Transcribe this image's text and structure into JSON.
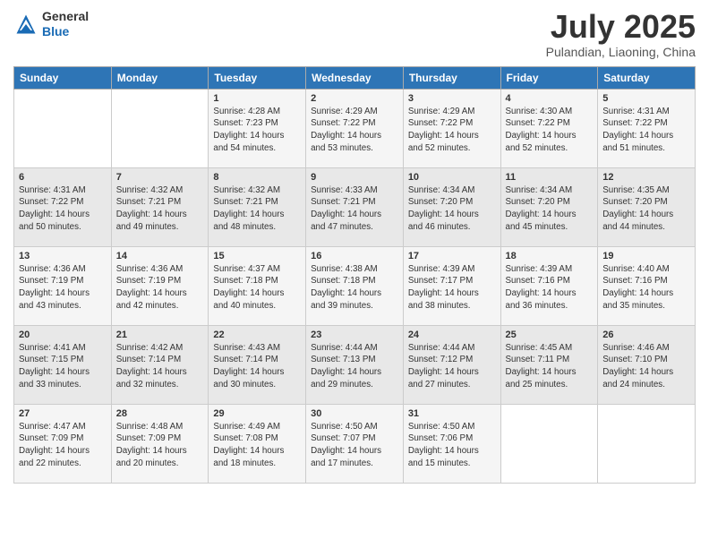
{
  "header": {
    "logo_line1": "General",
    "logo_line2": "Blue",
    "month_title": "July 2025",
    "location": "Pulandian, Liaoning, China"
  },
  "days_of_week": [
    "Sunday",
    "Monday",
    "Tuesday",
    "Wednesday",
    "Thursday",
    "Friday",
    "Saturday"
  ],
  "weeks": [
    [
      {
        "day": "",
        "info": ""
      },
      {
        "day": "",
        "info": ""
      },
      {
        "day": "1",
        "info": "Sunrise: 4:28 AM\nSunset: 7:23 PM\nDaylight: 14 hours and 54 minutes."
      },
      {
        "day": "2",
        "info": "Sunrise: 4:29 AM\nSunset: 7:22 PM\nDaylight: 14 hours and 53 minutes."
      },
      {
        "day": "3",
        "info": "Sunrise: 4:29 AM\nSunset: 7:22 PM\nDaylight: 14 hours and 52 minutes."
      },
      {
        "day": "4",
        "info": "Sunrise: 4:30 AM\nSunset: 7:22 PM\nDaylight: 14 hours and 52 minutes."
      },
      {
        "day": "5",
        "info": "Sunrise: 4:31 AM\nSunset: 7:22 PM\nDaylight: 14 hours and 51 minutes."
      }
    ],
    [
      {
        "day": "6",
        "info": "Sunrise: 4:31 AM\nSunset: 7:22 PM\nDaylight: 14 hours and 50 minutes."
      },
      {
        "day": "7",
        "info": "Sunrise: 4:32 AM\nSunset: 7:21 PM\nDaylight: 14 hours and 49 minutes."
      },
      {
        "day": "8",
        "info": "Sunrise: 4:32 AM\nSunset: 7:21 PM\nDaylight: 14 hours and 48 minutes."
      },
      {
        "day": "9",
        "info": "Sunrise: 4:33 AM\nSunset: 7:21 PM\nDaylight: 14 hours and 47 minutes."
      },
      {
        "day": "10",
        "info": "Sunrise: 4:34 AM\nSunset: 7:20 PM\nDaylight: 14 hours and 46 minutes."
      },
      {
        "day": "11",
        "info": "Sunrise: 4:34 AM\nSunset: 7:20 PM\nDaylight: 14 hours and 45 minutes."
      },
      {
        "day": "12",
        "info": "Sunrise: 4:35 AM\nSunset: 7:20 PM\nDaylight: 14 hours and 44 minutes."
      }
    ],
    [
      {
        "day": "13",
        "info": "Sunrise: 4:36 AM\nSunset: 7:19 PM\nDaylight: 14 hours and 43 minutes."
      },
      {
        "day": "14",
        "info": "Sunrise: 4:36 AM\nSunset: 7:19 PM\nDaylight: 14 hours and 42 minutes."
      },
      {
        "day": "15",
        "info": "Sunrise: 4:37 AM\nSunset: 7:18 PM\nDaylight: 14 hours and 40 minutes."
      },
      {
        "day": "16",
        "info": "Sunrise: 4:38 AM\nSunset: 7:18 PM\nDaylight: 14 hours and 39 minutes."
      },
      {
        "day": "17",
        "info": "Sunrise: 4:39 AM\nSunset: 7:17 PM\nDaylight: 14 hours and 38 minutes."
      },
      {
        "day": "18",
        "info": "Sunrise: 4:39 AM\nSunset: 7:16 PM\nDaylight: 14 hours and 36 minutes."
      },
      {
        "day": "19",
        "info": "Sunrise: 4:40 AM\nSunset: 7:16 PM\nDaylight: 14 hours and 35 minutes."
      }
    ],
    [
      {
        "day": "20",
        "info": "Sunrise: 4:41 AM\nSunset: 7:15 PM\nDaylight: 14 hours and 33 minutes."
      },
      {
        "day": "21",
        "info": "Sunrise: 4:42 AM\nSunset: 7:14 PM\nDaylight: 14 hours and 32 minutes."
      },
      {
        "day": "22",
        "info": "Sunrise: 4:43 AM\nSunset: 7:14 PM\nDaylight: 14 hours and 30 minutes."
      },
      {
        "day": "23",
        "info": "Sunrise: 4:44 AM\nSunset: 7:13 PM\nDaylight: 14 hours and 29 minutes."
      },
      {
        "day": "24",
        "info": "Sunrise: 4:44 AM\nSunset: 7:12 PM\nDaylight: 14 hours and 27 minutes."
      },
      {
        "day": "25",
        "info": "Sunrise: 4:45 AM\nSunset: 7:11 PM\nDaylight: 14 hours and 25 minutes."
      },
      {
        "day": "26",
        "info": "Sunrise: 4:46 AM\nSunset: 7:10 PM\nDaylight: 14 hours and 24 minutes."
      }
    ],
    [
      {
        "day": "27",
        "info": "Sunrise: 4:47 AM\nSunset: 7:09 PM\nDaylight: 14 hours and 22 minutes."
      },
      {
        "day": "28",
        "info": "Sunrise: 4:48 AM\nSunset: 7:09 PM\nDaylight: 14 hours and 20 minutes."
      },
      {
        "day": "29",
        "info": "Sunrise: 4:49 AM\nSunset: 7:08 PM\nDaylight: 14 hours and 18 minutes."
      },
      {
        "day": "30",
        "info": "Sunrise: 4:50 AM\nSunset: 7:07 PM\nDaylight: 14 hours and 17 minutes."
      },
      {
        "day": "31",
        "info": "Sunrise: 4:50 AM\nSunset: 7:06 PM\nDaylight: 14 hours and 15 minutes."
      },
      {
        "day": "",
        "info": ""
      },
      {
        "day": "",
        "info": ""
      }
    ]
  ]
}
